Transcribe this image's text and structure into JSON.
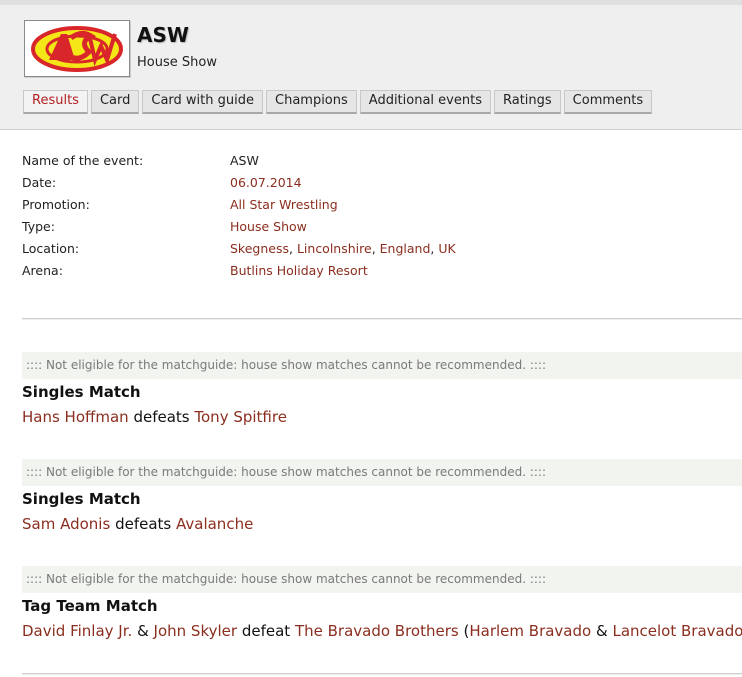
{
  "header": {
    "title": "ASW",
    "subtitle": "House Show",
    "logo_text": "ASW"
  },
  "tabs": [
    {
      "label": "Results",
      "active": true
    },
    {
      "label": "Card",
      "active": false
    },
    {
      "label": "Card with guide",
      "active": false
    },
    {
      "label": "Champions",
      "active": false
    },
    {
      "label": "Additional events",
      "active": false
    },
    {
      "label": "Ratings",
      "active": false
    },
    {
      "label": "Comments",
      "active": false
    }
  ],
  "info": {
    "name_label": "Name of the event:",
    "name_value": "ASW",
    "date_label": "Date:",
    "date_value": "06.07.2014",
    "promotion_label": "Promotion:",
    "promotion_value": "All Star Wrestling",
    "type_label": "Type:",
    "type_value": "House Show",
    "location_label": "Location:",
    "location_parts": [
      "Skegness",
      "Lincolnshire",
      "England",
      "UK"
    ],
    "arena_label": "Arena:",
    "arena_value": "Butlins Holiday Resort"
  },
  "matches": [
    {
      "notice": ":::: Not eligible for the matchguide: house show matches cannot be recommended. ::::",
      "type": "Singles Match",
      "winner": "Hans Hoffman",
      "verb": "defeats",
      "loser": "Tony Spitfire"
    },
    {
      "notice": ":::: Not eligible for the matchguide: house show matches cannot be recommended. ::::",
      "type": "Singles Match",
      "winner": "Sam Adonis",
      "verb": "defeats",
      "loser": "Avalanche"
    },
    {
      "notice": ":::: Not eligible for the matchguide: house show matches cannot be recommended. ::::",
      "type": "Tag Team Match",
      "winner1": "David Finlay Jr.",
      "amp": "&",
      "winner2": "John Skyler",
      "verb": "defeat",
      "team": "The Bravado Brothers",
      "member1": "Harlem Bravado",
      "member2": "Lancelot Bravado"
    }
  ],
  "colors": {
    "link": "#8b2e1f",
    "active_tab": "#b22222",
    "notice_bg": "#f1f4ef",
    "logo_yellow": "#f5e617",
    "logo_red": "#d8262a"
  }
}
